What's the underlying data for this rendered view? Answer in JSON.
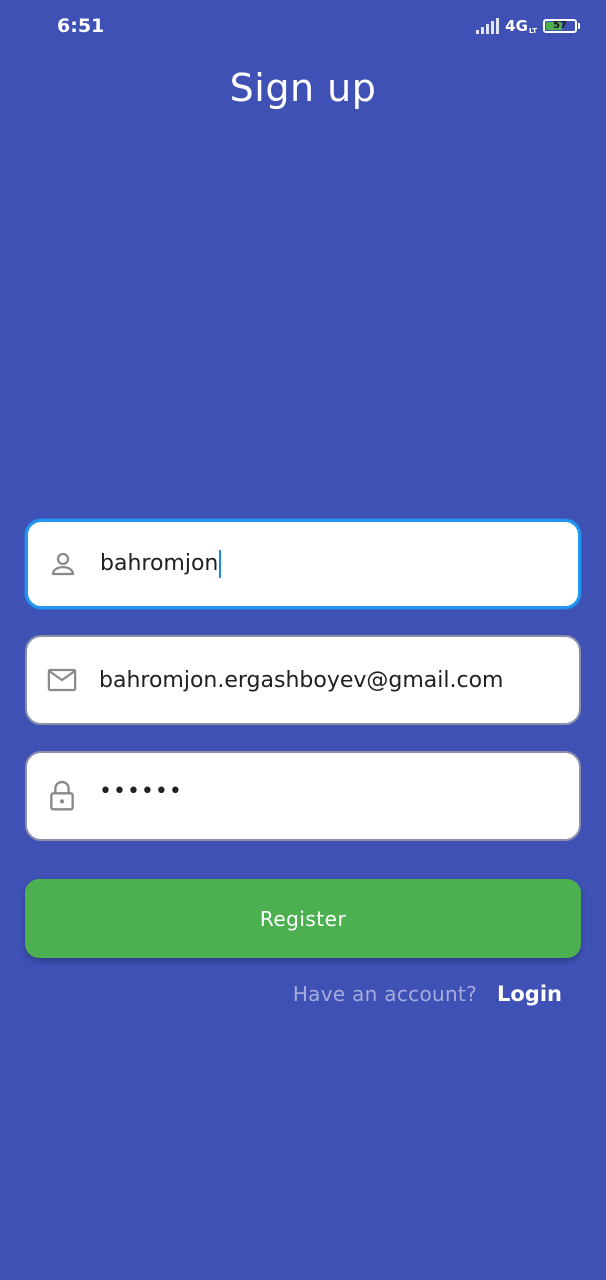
{
  "status_bar": {
    "time": "6:51",
    "network": "4G",
    "network_sub": "LT",
    "battery": "57"
  },
  "title": "Sign up",
  "form": {
    "username": {
      "value": "bahromjon",
      "icon": "person-icon"
    },
    "email": {
      "value": "bahromjon.ergashboyev@gmail.com",
      "icon": "mail-icon"
    },
    "password": {
      "value": "••••••",
      "icon": "lock-icon"
    }
  },
  "register_label": "Register",
  "footer": {
    "question": "Have an account?",
    "login_label": "Login"
  },
  "colors": {
    "background": "#3f51b5",
    "button": "#4caf50",
    "focus_border": "#2196f3"
  }
}
